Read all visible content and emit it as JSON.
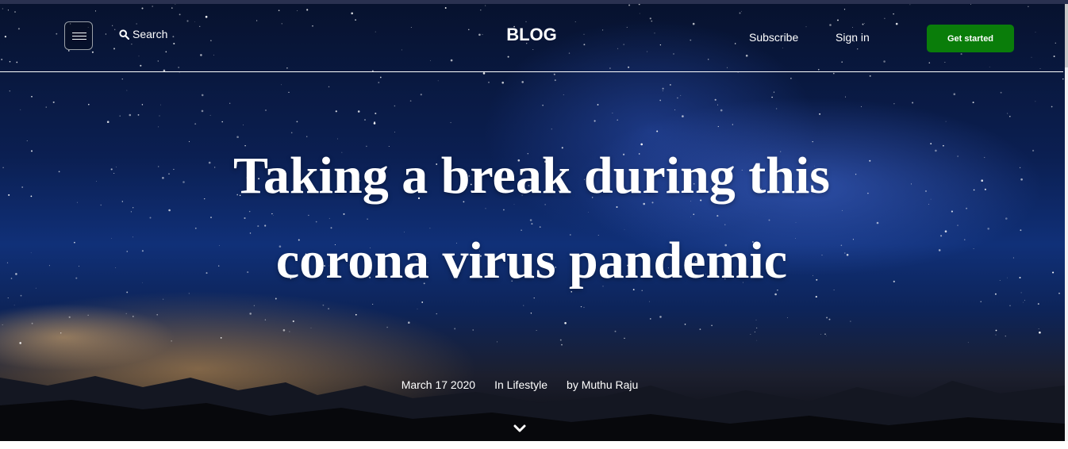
{
  "nav": {
    "search_label": "Search",
    "brand": "BLOG",
    "subscribe": "Subscribe",
    "signin": "Sign in",
    "cta": "Get started"
  },
  "post": {
    "title_line1": "Taking a break during this",
    "title_line2": "corona virus pandemic",
    "date": "March 17 2020",
    "category": "In Lifestyle",
    "author": "by Muthu Raju"
  },
  "icons": {
    "menu": "hamburger-icon",
    "search": "search-icon",
    "scroll": "chevron-down-icon"
  },
  "colors": {
    "cta_background": "#0a7d0a",
    "sky": "#0b1f52",
    "text": "#ffffff"
  }
}
